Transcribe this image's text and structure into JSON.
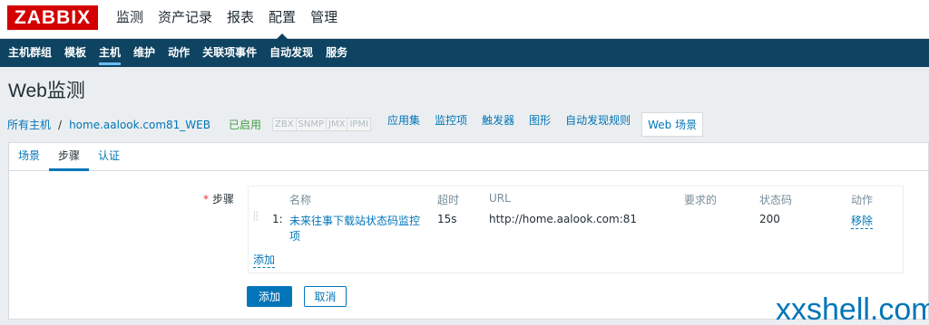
{
  "app": {
    "logo": "ZABBIX"
  },
  "main_menu": [
    {
      "label": "监测",
      "active": false
    },
    {
      "label": "资产记录",
      "active": false
    },
    {
      "label": "报表",
      "active": false
    },
    {
      "label": "配置",
      "active": true
    },
    {
      "label": "管理",
      "active": false
    }
  ],
  "sub_menu": [
    {
      "label": "主机群组",
      "active": false
    },
    {
      "label": "模板",
      "active": false
    },
    {
      "label": "主机",
      "active": true
    },
    {
      "label": "维护",
      "active": false
    },
    {
      "label": "动作",
      "active": false
    },
    {
      "label": "关联项事件",
      "active": false
    },
    {
      "label": "自动发现",
      "active": false
    },
    {
      "label": "服务",
      "active": false
    }
  ],
  "page": {
    "title": "Web监测"
  },
  "host_nav": {
    "all_hosts": "所有主机",
    "separator": "/",
    "host": "home.aalook.com81_WEB",
    "status": "已启用",
    "availability": [
      "ZBX",
      "SNMP",
      "JMX",
      "IPMI"
    ],
    "links": [
      "应用集",
      "监控项",
      "触发器",
      "图形",
      "自动发现规则"
    ],
    "current": "Web 场景"
  },
  "tabs": [
    {
      "label": "场景",
      "active": false
    },
    {
      "label": "步骤",
      "active": true
    },
    {
      "label": "认证",
      "active": false
    }
  ],
  "steps": {
    "label": "步骤",
    "required_mark": "*",
    "columns": {
      "name": "名称",
      "timeout": "超时",
      "url": "URL",
      "required": "要求的",
      "status_codes": "状态码",
      "action": "动作"
    },
    "rows": [
      {
        "index": "1:",
        "name": "未来往事下载站状态码监控项",
        "timeout": "15s",
        "url": "http://home.aalook.com:81",
        "required": "",
        "status_codes": "200",
        "action": "移除"
      }
    ],
    "add_link": "添加"
  },
  "buttons": {
    "add": "添加",
    "cancel": "取消"
  },
  "watermark": "xxshell.com",
  "colors": {
    "brand": "#d40000",
    "nav": "#0e4361",
    "link": "#0275b8",
    "enabled": "#429e47"
  }
}
